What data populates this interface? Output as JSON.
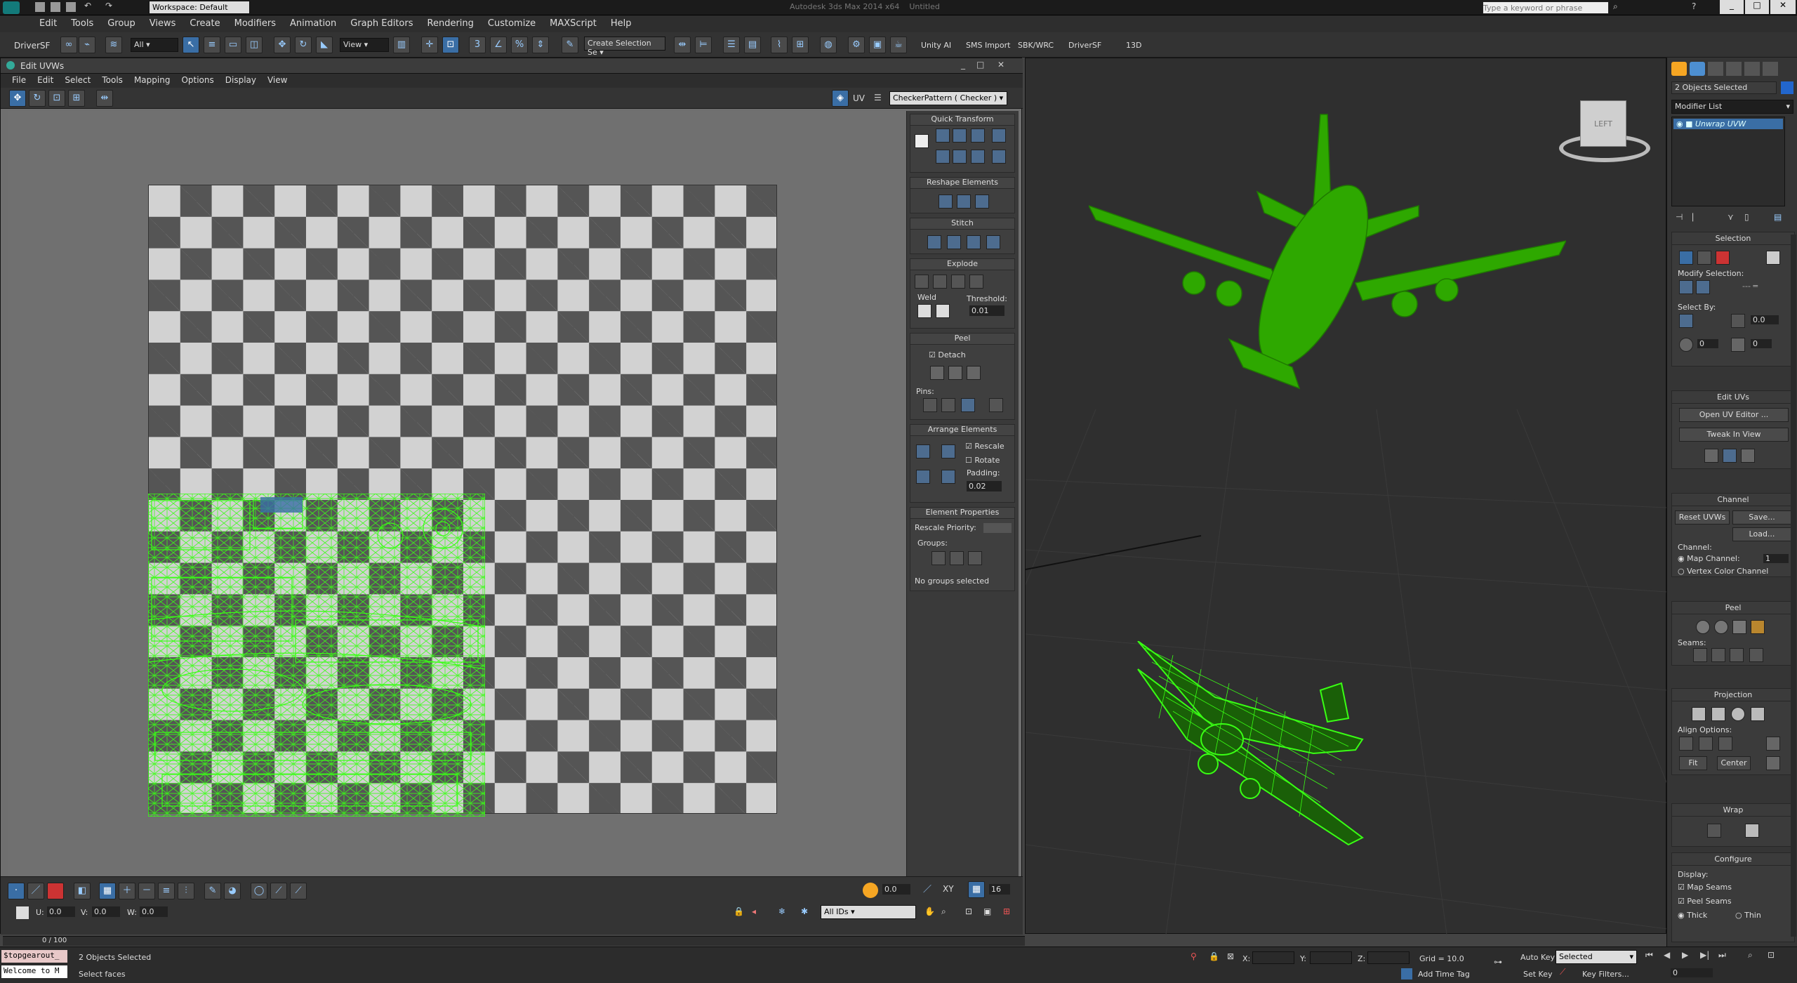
{
  "app": {
    "workspace": "Workspace: Default",
    "title": "Autodesk 3ds Max  2014 x64",
    "doc": "Untitled",
    "search_placeholder": "Type a keyword or phrase"
  },
  "menu": [
    "Edit",
    "Tools",
    "Group",
    "Views",
    "Create",
    "Modifiers",
    "Animation",
    "Graph Editors",
    "Rendering",
    "Customize",
    "MAXScript",
    "Help"
  ],
  "toolbar": {
    "driver_label": "DriverSF",
    "filter": "All",
    "view": "View",
    "selection_set_placeholder": "Create Selection Se",
    "right_items": [
      "Unity AI",
      "SMS Import",
      "SBK/WRC",
      "DriverSF",
      "13D"
    ]
  },
  "uv_editor": {
    "title": "Edit UVWs",
    "menu": [
      "File",
      "Edit",
      "Select",
      "Tools",
      "Mapping",
      "Options",
      "Display",
      "View"
    ],
    "uv_label": "UV",
    "texture": "CheckerPattern  ( Checker )",
    "quick_transform": "Quick Transform",
    "reshape": "Reshape Elements",
    "stitch": "Stitch",
    "explode": "Explode",
    "weld": "Weld",
    "threshold_label": "Threshold:",
    "threshold": "0.01",
    "peel": "Peel",
    "detach": "Detach",
    "pins": "Pins:",
    "arrange": "Arrange Elements",
    "rescale": "Rescale",
    "rotate": "Rotate",
    "padding_label": "Padding:",
    "padding": "0.02",
    "element_props": "Element Properties",
    "rescale_priority": "Rescale Priority:",
    "groups": "Groups:",
    "no_groups": "No groups selected",
    "spinner1": "0.0",
    "spinner2": "16",
    "all_ids": "All IDs",
    "u_label": "U:",
    "v_label": "V:",
    "w_label": "W:",
    "u": "0.0",
    "v": "0.0",
    "w": "0.0",
    "xy_label": "XY"
  },
  "command_panel": {
    "objects_selected": "2 Objects Selected",
    "modifier_list": "Modifier List",
    "stack_item": "Unwrap UVW",
    "selection": "Selection",
    "modify_selection": "Modify Selection:",
    "select_by": "Select By:",
    "select_by_values": [
      "0.0",
      "0",
      "0"
    ],
    "edit_uvs": "Edit UVs",
    "open_uv_editor": "Open UV Editor ...",
    "tweak_in_view": "Tweak In View",
    "channel": "Channel",
    "reset_uvws": "Reset UVWs",
    "save": "Save...",
    "load": "Load...",
    "channel_label": "Channel:",
    "map_channel": "Map Channel:",
    "map_channel_value": "1",
    "vertex_color": "Vertex Color Channel",
    "peel": "Peel",
    "seams": "Seams:",
    "projection": "Projection",
    "align_options": "Align Options:",
    "fit": "Fit",
    "center": "Center",
    "wrap": "Wrap",
    "configure": "Configure",
    "display": "Display:",
    "map_seams": "Map Seams",
    "peel_seams": "Peel Seams",
    "thick": "Thick",
    "thin": "Thin"
  },
  "status": {
    "script": "$topgearout_",
    "welcome": "Welcome to M",
    "objects_selected": "2 Objects Selected",
    "prompt": "Select faces",
    "frame": "0 / 100",
    "x": "X:",
    "y": "Y:",
    "z": "Z:",
    "grid": "Grid = 10.0",
    "auto_key": "Auto Key",
    "selected": "Selected",
    "set_key": "Set Key",
    "key_filters": "Key Filters...",
    "add_time_tag": "Add Time Tag",
    "frame_no": "0"
  },
  "viewcube_label": "LEFT",
  "colors": {
    "wire": "#39ff14",
    "plane_solid": "#2ea800",
    "selection_blue": "#3a6ea5"
  }
}
